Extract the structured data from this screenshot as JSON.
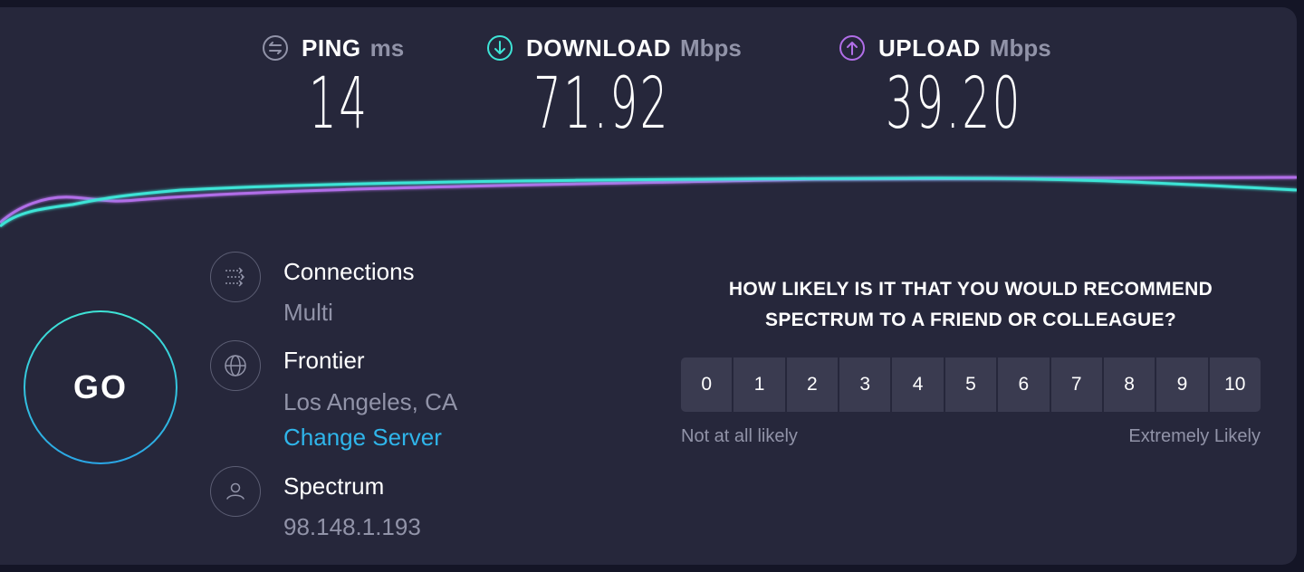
{
  "metrics": {
    "ping": {
      "label": "PING",
      "unit": "ms",
      "value": "14",
      "icon": "ping-arrows-icon",
      "color": "#9193a8"
    },
    "download": {
      "label": "DOWNLOAD",
      "unit": "Mbps",
      "value": "71.92",
      "icon": "download-arrow-icon",
      "color": "#3ee4d6"
    },
    "upload": {
      "label": "UPLOAD",
      "unit": "Mbps",
      "value": "39.20",
      "icon": "upload-arrow-icon",
      "color": "#b16ee8"
    }
  },
  "go_button": {
    "label": "GO"
  },
  "connection_info": {
    "connections": {
      "title": "Connections",
      "value": "Multi"
    },
    "server": {
      "title": "Frontier",
      "location": "Los Angeles, CA",
      "change_link": "Change Server"
    },
    "provider": {
      "title": "Spectrum",
      "ip": "98.148.1.193"
    }
  },
  "survey": {
    "question": "HOW LIKELY IS IT THAT YOU WOULD RECOMMEND SPECTRUM TO A FRIEND OR COLLEAGUE?",
    "scale": [
      "0",
      "1",
      "2",
      "3",
      "4",
      "5",
      "6",
      "7",
      "8",
      "9",
      "10"
    ],
    "low_label": "Not at all likely",
    "high_label": "Extremely Likely"
  },
  "colors": {
    "background": "#26273b",
    "download": "#3ee4d6",
    "upload": "#b16ee8",
    "link": "#2fb5ea"
  }
}
